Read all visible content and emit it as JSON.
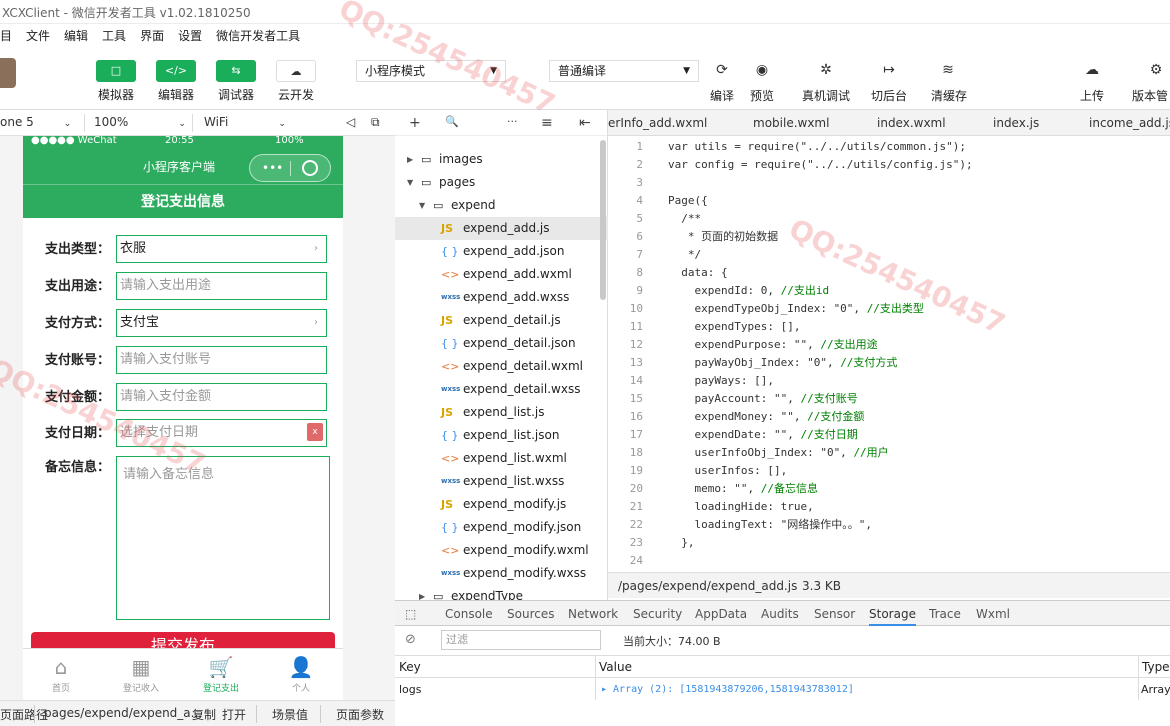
{
  "window": {
    "title": "XCXClient - 微信开发者工具 v1.02.1810250"
  },
  "menu": [
    "目",
    "文件",
    "编辑",
    "工具",
    "界面",
    "设置",
    "微信开发者工具"
  ],
  "toolbar": {
    "simulator": {
      "icon": "□",
      "label": "模拟器"
    },
    "editor": {
      "icon": "</>",
      "label": "编辑器"
    },
    "debugger": {
      "icon": "⇆",
      "label": "调试器"
    },
    "cloud": {
      "icon": "☁",
      "label": "云开发"
    },
    "mode_select": "小程序模式",
    "compile_select": "普通编译",
    "compile_label": "编译",
    "preview_label": "预览",
    "remote_debug_label": "真机调试",
    "background_label": "切后台",
    "clear_cache_label": "清缓存",
    "upload_label": "上传",
    "version_label": "版本管"
  },
  "device_bar": {
    "device": "one 5",
    "zoom": "100%",
    "network": "WiFi"
  },
  "phone": {
    "status_carrier": "●●●●● WeChat",
    "status_time": "20:55",
    "status_battery": "100%",
    "nav_title": "小程序客户端",
    "capsule_dots": "•••",
    "page_header": "登记支出信息",
    "form": {
      "type_label": "支出类型：",
      "type_value": "衣服",
      "purpose_label": "支出用途：",
      "purpose_placeholder": "请输入支出用途",
      "payway_label": "支付方式：",
      "payway_value": "支付宝",
      "account_label": "支付账号：",
      "account_placeholder": "请输入支付账号",
      "money_label": "支付金额：",
      "money_placeholder": "请输入支付金额",
      "date_label": "支付日期：",
      "date_placeholder": "选择支付日期",
      "date_clear": "x",
      "memo_label": "备忘信息：",
      "memo_placeholder": "请输入备忘信息"
    },
    "submit": "提交发布",
    "tabs": [
      {
        "icon": "⌂",
        "label": "首页"
      },
      {
        "icon": "▦",
        "label": "登记收入"
      },
      {
        "icon": "🛒",
        "label": "登记支出"
      },
      {
        "icon": "👤",
        "label": "个人"
      }
    ]
  },
  "explorer": {
    "head_icons": [
      "+",
      "🔍",
      "···",
      "≡",
      "⇤"
    ],
    "tree": [
      {
        "name": "images",
        "kind": "folder",
        "depth": 0,
        "open": false
      },
      {
        "name": "pages",
        "kind": "folder",
        "depth": 0,
        "open": true
      },
      {
        "name": "expend",
        "kind": "folder",
        "depth": 1,
        "open": true
      },
      {
        "name": "expend_add.js",
        "kind": "js",
        "depth": 2,
        "selected": true
      },
      {
        "name": "expend_add.json",
        "kind": "json",
        "depth": 2
      },
      {
        "name": "expend_add.wxml",
        "kind": "wxml",
        "depth": 2
      },
      {
        "name": "expend_add.wxss",
        "kind": "wxss",
        "depth": 2
      },
      {
        "name": "expend_detail.js",
        "kind": "js",
        "depth": 2
      },
      {
        "name": "expend_detail.json",
        "kind": "json",
        "depth": 2
      },
      {
        "name": "expend_detail.wxml",
        "kind": "wxml",
        "depth": 2
      },
      {
        "name": "expend_detail.wxss",
        "kind": "wxss",
        "depth": 2
      },
      {
        "name": "expend_list.js",
        "kind": "js",
        "depth": 2
      },
      {
        "name": "expend_list.json",
        "kind": "json",
        "depth": 2
      },
      {
        "name": "expend_list.wxml",
        "kind": "wxml",
        "depth": 2
      },
      {
        "name": "expend_list.wxss",
        "kind": "wxss",
        "depth": 2
      },
      {
        "name": "expend_modify.js",
        "kind": "js",
        "depth": 2
      },
      {
        "name": "expend_modify.json",
        "kind": "json",
        "depth": 2
      },
      {
        "name": "expend_modify.wxml",
        "kind": "wxml",
        "depth": 2
      },
      {
        "name": "expend_modify.wxss",
        "kind": "wxss",
        "depth": 2
      },
      {
        "name": "expendType",
        "kind": "folder",
        "depth": 1,
        "open": false
      }
    ]
  },
  "editor_tabs": [
    "erInfo_add.wxml",
    "mobile.wxml",
    "index.wxml",
    "index.js",
    "income_add.js"
  ],
  "code": [
    {
      "n": "1",
      "t": "var utils = require(\"../../utils/common.js\");"
    },
    {
      "n": "2",
      "t": "var config = require(\"../../utils/config.js\");"
    },
    {
      "n": "3",
      "t": ""
    },
    {
      "n": "4",
      "t": "Page({"
    },
    {
      "n": "5",
      "t": "  /**"
    },
    {
      "n": "6",
      "t": "   * 页面的初始数据"
    },
    {
      "n": "7",
      "t": "   */"
    },
    {
      "n": "8",
      "t": "  data: {"
    },
    {
      "n": "9",
      "t": "    expendId: 0, //支出id"
    },
    {
      "n": "10",
      "t": "    expendTypeObj_Index: \"0\", //支出类型"
    },
    {
      "n": "11",
      "t": "    expendTypes: [],"
    },
    {
      "n": "12",
      "t": "    expendPurpose: \"\", //支出用途"
    },
    {
      "n": "13",
      "t": "    payWayObj_Index: \"0\", //支付方式"
    },
    {
      "n": "14",
      "t": "    payWays: [],"
    },
    {
      "n": "15",
      "t": "    payAccount: \"\", //支付账号"
    },
    {
      "n": "16",
      "t": "    expendMoney: \"\", //支付金额"
    },
    {
      "n": "17",
      "t": "    expendDate: \"\", //支付日期"
    },
    {
      "n": "18",
      "t": "    userInfoObj_Index: \"0\", //用户"
    },
    {
      "n": "19",
      "t": "    userInfos: [],"
    },
    {
      "n": "20",
      "t": "    memo: \"\", //备忘信息"
    },
    {
      "n": "21",
      "t": "    loadingHide: true,"
    },
    {
      "n": "22",
      "t": "    loadingText: \"网络操作中。。\","
    },
    {
      "n": "23",
      "t": "  },"
    },
    {
      "n": "24",
      "t": ""
    }
  ],
  "editor_status": {
    "path": "/pages/expend/expend_add.js",
    "size": "3.3 KB"
  },
  "devtools": {
    "tabs": [
      "Console",
      "Sources",
      "Network",
      "Security",
      "AppData",
      "Audits",
      "Sensor",
      "Storage",
      "Trace",
      "Wxml"
    ],
    "active": "Storage",
    "filter_placeholder": "过滤",
    "current_size": "当前大小：74.00 B",
    "columns": [
      "Key",
      "Value",
      "Type"
    ],
    "rows": [
      {
        "key": "logs",
        "value": "▸ Array (2): [1581943879206,1581943783012]",
        "type": "Array"
      }
    ]
  },
  "bottom": {
    "path_label": "页面路径",
    "path": "pages/expend/expend_a...",
    "copy": "复制",
    "open": "打开",
    "scene": "场景值",
    "params": "页面参数"
  }
}
